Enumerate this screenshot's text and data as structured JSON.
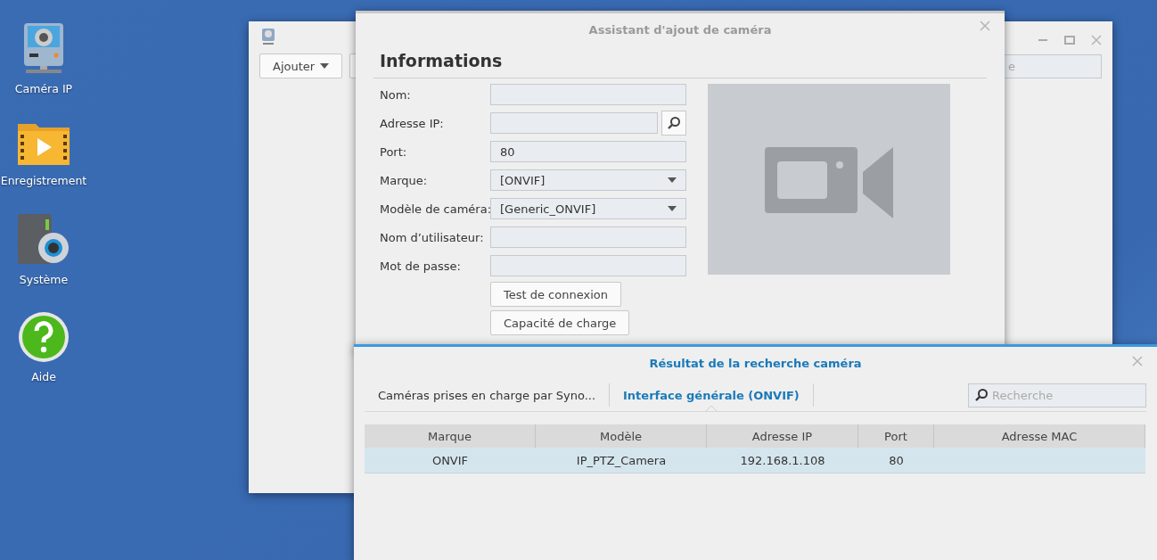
{
  "desktop_icons": [
    {
      "kind": "camera",
      "label": "Caméra IP"
    },
    {
      "kind": "recording",
      "label": "Enregistrement"
    },
    {
      "kind": "system",
      "label": "Système"
    },
    {
      "kind": "help",
      "label": "Aide"
    }
  ],
  "back_window": {
    "add_button": "Ajouter",
    "search": {
      "placeholder": "e"
    }
  },
  "wizard": {
    "title": "Assistant d'ajout de caméra",
    "heading": "Informations",
    "fields": [
      {
        "kind": "text",
        "label": "Nom:"
      },
      {
        "kind": "search",
        "label": "Adresse IP:"
      },
      {
        "kind": "text",
        "label": "Port:",
        "value": "80"
      },
      {
        "kind": "select",
        "label": "Marque:",
        "value": "[ONVIF]"
      },
      {
        "kind": "select",
        "label": "Modèle de caméra:",
        "value": "[Generic_ONVIF]"
      },
      {
        "kind": "text",
        "label": "Nom d’utilisateur:"
      },
      {
        "kind": "password",
        "label": "Mot de passe:"
      }
    ],
    "buttons": [
      "Test de connexion",
      "Capacité de charge"
    ],
    "preview": {
      "kind": "placeholder"
    }
  },
  "results": {
    "title": "Résultat de la recherche caméra",
    "tabs": [
      {
        "label": "Caméras prises en charge par Syno...",
        "selected": false
      },
      {
        "label": "Interface générale (ONVIF)",
        "selected": true
      }
    ],
    "search": {
      "placeholder": "Recherche"
    },
    "table": {
      "columns": [
        "Marque",
        "Modèle",
        "Adresse IP",
        "Port",
        "Adresse MAC"
      ],
      "rows": [
        {
          "cells": [
            "ONVIF",
            "IP_PTZ_Camera",
            "192.168.1.108",
            "80"
          ],
          "selected": true
        }
      ]
    }
  }
}
